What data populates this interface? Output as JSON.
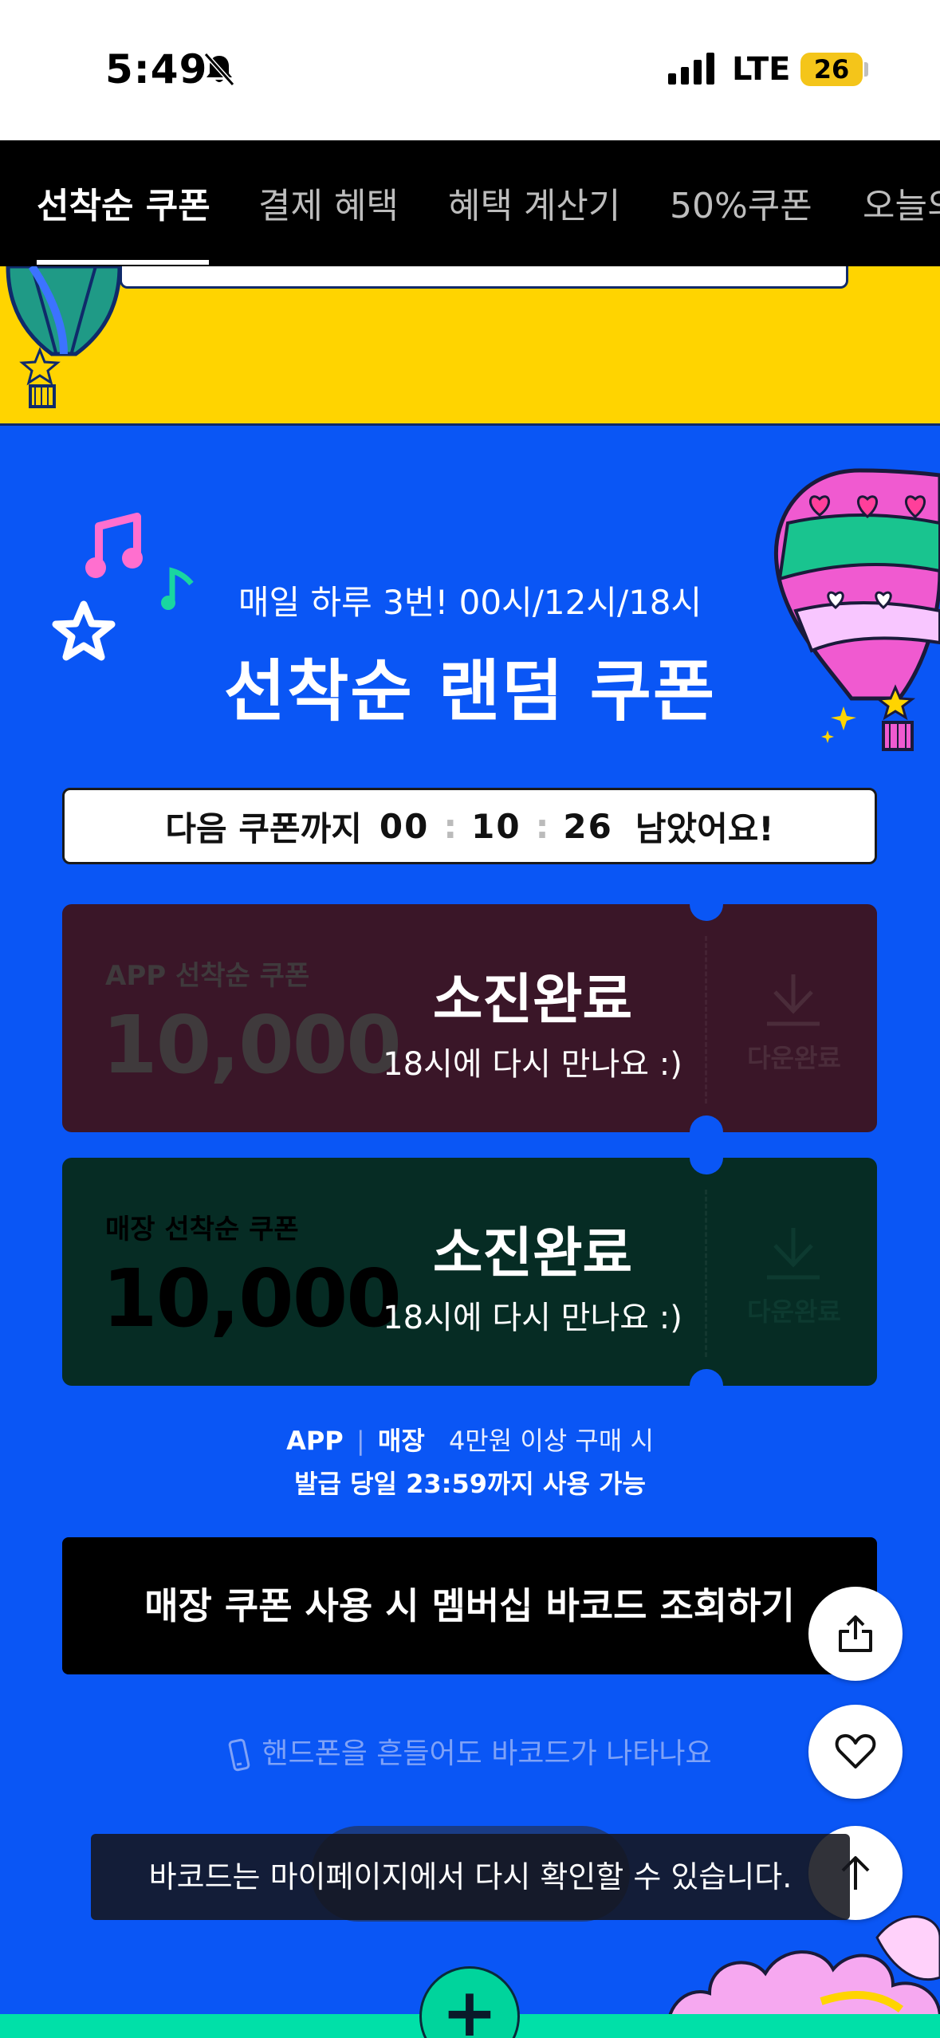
{
  "status_bar": {
    "time": "5:49",
    "network": "LTE",
    "battery": "26"
  },
  "tabs": [
    {
      "label": "선착순 쿠폰",
      "active": true
    },
    {
      "label": "결제 혜택",
      "active": false
    },
    {
      "label": "혜택 계산기",
      "active": false
    },
    {
      "label": "50%쿠폰",
      "active": false
    },
    {
      "label": "오늘의",
      "active": false
    }
  ],
  "hero": {
    "subtitle": "매일 하루 3번! 00시/12시/18시",
    "title": "선착순 랜덤 쿠폰"
  },
  "countdown": {
    "prefix": "다음 쿠폰까지",
    "hours": "00",
    "minutes": "10",
    "seconds": "26",
    "separator": ":",
    "suffix": "남았어요!"
  },
  "coupons": [
    {
      "label": "APP 선착순 쿠폰",
      "amount": "10,000",
      "download_label": "다운완료",
      "status_title": "소진완료",
      "status_sub": "18시에 다시 만나요 :)",
      "color": "#3a1628"
    },
    {
      "label": "매장 선착순 쿠폰",
      "amount": "10,000",
      "download_label": "다운완료",
      "status_title": "소진완료",
      "status_sub": "18시에 다시 만나요 :)",
      "color": "#062c24"
    }
  ],
  "notes": {
    "channel_app": "APP",
    "channel_sep": "|",
    "channel_store": "매장",
    "condition": "4만원 이상 구매 시",
    "validity": "발급 당일 23:59까지 사용 가능"
  },
  "barcode_button": "매장 쿠폰 사용 시 멤버십 바코드 조회하기",
  "shake_tip": "핸드폰을 흔들어도 바코드가 나타나요",
  "toast": "바코드는 마이페이지에서 다시 확인할 수 있습니다.",
  "fabs": {
    "share": "share-icon",
    "like": "heart-icon",
    "top": "arrow-up-icon"
  },
  "colors": {
    "primary_blue": "#0a56f5",
    "yellow": "#ffd400",
    "mint": "#00e0a8"
  }
}
